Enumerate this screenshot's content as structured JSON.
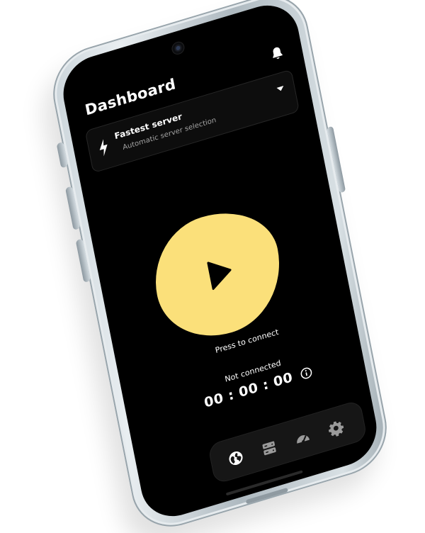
{
  "dashboard": {
    "title": "Dashboard"
  },
  "server": {
    "name": "Fastest server",
    "subtitle": "Automatic server selection"
  },
  "connection": {
    "press_label": "Press to connect",
    "status": "Not connected",
    "timer": "00 : 00 : 00"
  },
  "colors": {
    "accent": "#fbe07a",
    "background": "#000000",
    "nav_background": "#161616"
  },
  "icons": {
    "notifications": "bell-icon",
    "server": "bolt-icon",
    "dropdown": "caret-down-icon",
    "connect": "play-icon",
    "info": "info-icon",
    "nav": [
      "globe-icon",
      "server-stack-icon",
      "speedometer-icon",
      "gear-icon"
    ]
  },
  "nav": {
    "active_index": 0
  }
}
